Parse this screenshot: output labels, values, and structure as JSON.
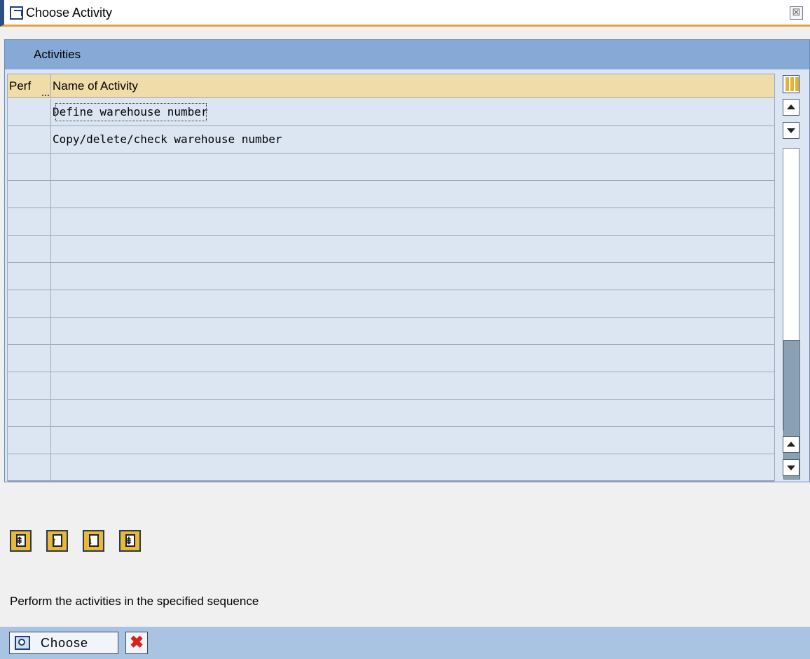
{
  "window": {
    "title": "Choose Activity",
    "close_glyph": "☒",
    "icon": "dialog-icon"
  },
  "frame": {
    "title": "Activities"
  },
  "table": {
    "columns": [
      "Perf",
      "Name of Activity"
    ],
    "rows": [
      {
        "perf": "",
        "name": "Define warehouse number",
        "focused": true
      },
      {
        "perf": "",
        "name": "Copy/delete/check warehouse number",
        "focused": false
      },
      {
        "perf": "",
        "name": ""
      },
      {
        "perf": "",
        "name": ""
      },
      {
        "perf": "",
        "name": ""
      },
      {
        "perf": "",
        "name": ""
      },
      {
        "perf": "",
        "name": ""
      },
      {
        "perf": "",
        "name": ""
      },
      {
        "perf": "",
        "name": ""
      },
      {
        "perf": "",
        "name": ""
      },
      {
        "perf": "",
        "name": ""
      },
      {
        "perf": "",
        "name": ""
      },
      {
        "perf": "",
        "name": ""
      },
      {
        "perf": "",
        "name": ""
      }
    ]
  },
  "sequence_buttons": [
    {
      "name": "first-page-icon"
    },
    {
      "name": "previous-page-icon"
    },
    {
      "name": "next-page-icon"
    },
    {
      "name": "last-page-icon"
    }
  ],
  "hint": "Perform the activities in the specified sequence",
  "footer": {
    "choose_label": "Choose",
    "cancel_glyph": "✖"
  },
  "colors": {
    "header_accent": "#e6a23c",
    "frame_header": "#86a9d6",
    "table_header": "#f0dca8",
    "footer": "#a9c3e3",
    "cancel_red": "#d8201c"
  }
}
